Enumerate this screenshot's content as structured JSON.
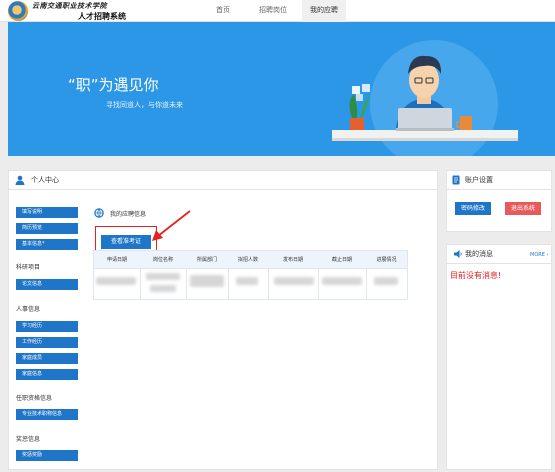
{
  "header": {
    "school_name": "云南交通职业技术学院",
    "system_name": "人才招聘系统",
    "nav": [
      "首页",
      "招聘岗位",
      "我的应聘"
    ],
    "active_nav": "我的应聘"
  },
  "banner": {
    "slogan": "“职”为遇见你",
    "subslogan": "寻找同道人，与你道未来"
  },
  "personal_center": {
    "title": "个人中心",
    "menu_top": [
      "填写说明",
      "简历预览",
      "基本信息*"
    ],
    "groups": [
      {
        "title": "科研项目",
        "items": [
          "论文信息"
        ]
      },
      {
        "title": "人事信息",
        "items": [
          "学习经历",
          "工作经历",
          "家庭成员",
          "家庭信息"
        ]
      },
      {
        "title": "任职资格信息",
        "items": [
          "专业技术职称信息"
        ]
      },
      {
        "title": "奖惩信息",
        "items": [
          "奖惩奖励"
        ]
      }
    ]
  },
  "my_applications": {
    "title": "我的应聘信息",
    "view_ticket_button": "查看准考证",
    "columns": [
      "申请日期",
      "岗位名称",
      "所属部门",
      "拟招人数",
      "发布日期",
      "截止日期",
      "进展情况"
    ]
  },
  "account": {
    "title": "账户设置",
    "change_password": "密码修改",
    "logout": "退出系统"
  },
  "messages": {
    "title": "我的消息",
    "more": "MORE ›",
    "empty": "目前没有消息!"
  },
  "colors": {
    "primary": "#1f76c9",
    "banner": "#2b97e6",
    "danger": "#e52222"
  }
}
